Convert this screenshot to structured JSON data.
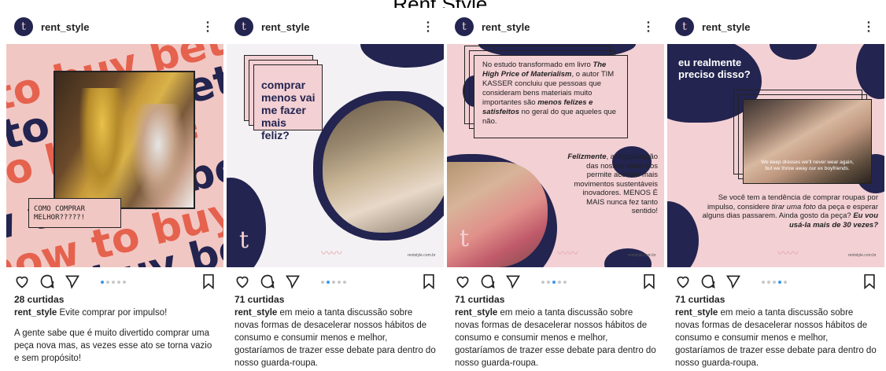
{
  "page_title": "Rent Style.",
  "colors": {
    "navy": "#23244f",
    "pink": "#f3d0d4",
    "coral": "#e5624e",
    "link_blue": "#3897f0"
  },
  "icons": [
    "heart-icon",
    "comment-icon",
    "share-icon",
    "bookmark-icon",
    "more-icon"
  ],
  "posts": [
    {
      "username": "rent_style",
      "more": "⋮",
      "media": {
        "words": [
          "to buy bet",
          "to buy bett",
          "to buy be",
          "w to buy be",
          "how to buy",
          "to buy bet"
        ],
        "label": "COMO COMPRAR MELHOR?????!"
      },
      "likes": "28 curtidas",
      "caption_user": "rent_style",
      "caption_text": " Evite comprar por impulso!",
      "caption_more": "A gente sabe que é muito divertido comprar uma peça nova mas, as vezes esse ato se torna vazio e sem propósito!"
    },
    {
      "username": "rent_style",
      "more": "⋮",
      "media": {
        "question": "comprar menos vai me fazer mais feliz?",
        "logo": "t",
        "url": "rentstyle.com.br"
      },
      "likes": "71 curtidas",
      "caption_user": "rent_style",
      "caption_text": " em meio a tanta discussão sobre novas formas de desacelerar nossos hábitos de consumo e consumir menos e melhor, gostaríamos de trazer esse debate para dentro do nosso guarda-roupa."
    },
    {
      "username": "rent_style",
      "more": "⋮",
      "media": {
        "card_p1": "No estudo transformado em livro ",
        "card_book": "The High Price of Materialism",
        "card_p2": ", o autor TIM KASSER concluiu que pessoas que consideram bens materiais muito importantes são ",
        "card_em": "menos felizes e satisfeitos",
        "card_p3": " no geral do que aqueles que não.",
        "body_em": "Felizmente",
        "body_text": ", a digitalização das nossas vidas nos permite acessar mais movimentos sustentáveis inovadores. MENOS É MAIS nunca fez tanto sentido!",
        "logo": "t",
        "url": "rentstyle.com.br"
      },
      "likes": "71 curtidas",
      "caption_user": "rent_style",
      "caption_text": " em meio a tanta discussão sobre novas formas de desacelerar nossos hábitos de consumo e consumir menos e melhor, gostaríamos de trazer esse debate para dentro do nosso guarda-roupa."
    },
    {
      "username": "rent_style",
      "more": "⋮",
      "media": {
        "question": "eu realmente preciso disso?",
        "subtitle1": "We keep dresses we'll never wear again,",
        "subtitle2": "but we throw away our ex boyfriends.",
        "body_p1": "Se você tem a tendência de comprar roupas por impulso, considere ",
        "body_em1": "tirar uma foto",
        "body_p2": " da peça e esperar alguns dias passarem. Ainda gosto da peça? ",
        "body_em2": "Eu vou usá-la mais de 30 vezes?",
        "logo": "t",
        "url": "rentstyle.com.br"
      },
      "likes": "71 curtidas",
      "caption_user": "rent_style",
      "caption_text": " em meio a tanta discussão sobre novas formas de desacelerar nossos hábitos de consumo e consumir menos e melhor, gostaríamos de trazer esse debate para dentro do nosso guarda-roupa."
    }
  ]
}
